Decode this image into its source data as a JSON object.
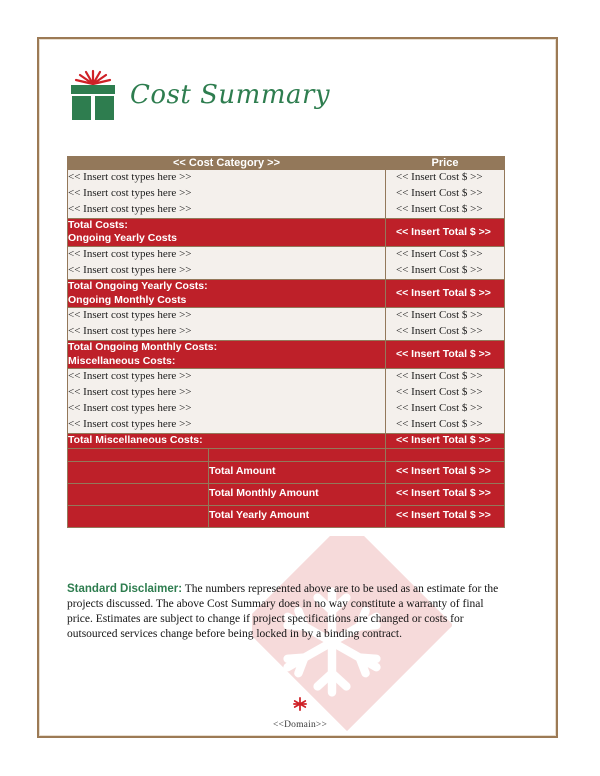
{
  "document": {
    "title": "Cost Summary",
    "logo_icon": "gift-box-icon"
  },
  "table": {
    "headers": {
      "category": "<< Cost Category >>",
      "price": "Price"
    },
    "cost_placeholder": "<< Insert cost types here >>",
    "price_placeholder": "<< Insert Cost $ >>",
    "total_placeholder": "<< Insert Total $ >>",
    "sections": [
      {
        "name": "initial-costs",
        "item_count": 3,
        "total_label": "Total Costs:",
        "next_heading": "Ongoing Yearly Costs"
      },
      {
        "name": "ongoing-yearly-costs",
        "item_count": 2,
        "total_label": "Total Ongoing Yearly Costs:",
        "next_heading": "Ongoing Monthly Costs"
      },
      {
        "name": "ongoing-monthly-costs",
        "item_count": 2,
        "total_label": "Total Ongoing Monthly Costs:",
        "next_heading": "Miscellaneous Costs:"
      },
      {
        "name": "miscellaneous-costs",
        "item_count": 4,
        "total_label": "Total Miscellaneous Costs:",
        "next_heading": ""
      }
    ],
    "grand_totals": [
      {
        "label": "Total Amount",
        "value": "<< Insert Total $ >>"
      },
      {
        "label": "Total Monthly Amount",
        "value": "<< Insert Total $ >>"
      },
      {
        "label": "Total Yearly Amount",
        "value": "<< Insert Total $ >>"
      }
    ]
  },
  "disclaimer": {
    "label": "Standard Disclaimer:",
    "body": " The numbers represented above are to be used as an estimate for the projects discussed. The above Cost Summary does in no way constitute a warranty of final price.  Estimates are subject to change if project specifications are changed or costs for outsourced services change before being locked in by a binding contract."
  },
  "footer": {
    "icon": "snowflake-icon",
    "text": "<<Domain>>"
  },
  "colors": {
    "accent_red": "#be2029",
    "header_brown": "#93785a",
    "green": "#2e7d4f",
    "light_row": "#f4f0ec",
    "border_tan": "#9c7a55",
    "watermark_pink": "#f6dada"
  }
}
